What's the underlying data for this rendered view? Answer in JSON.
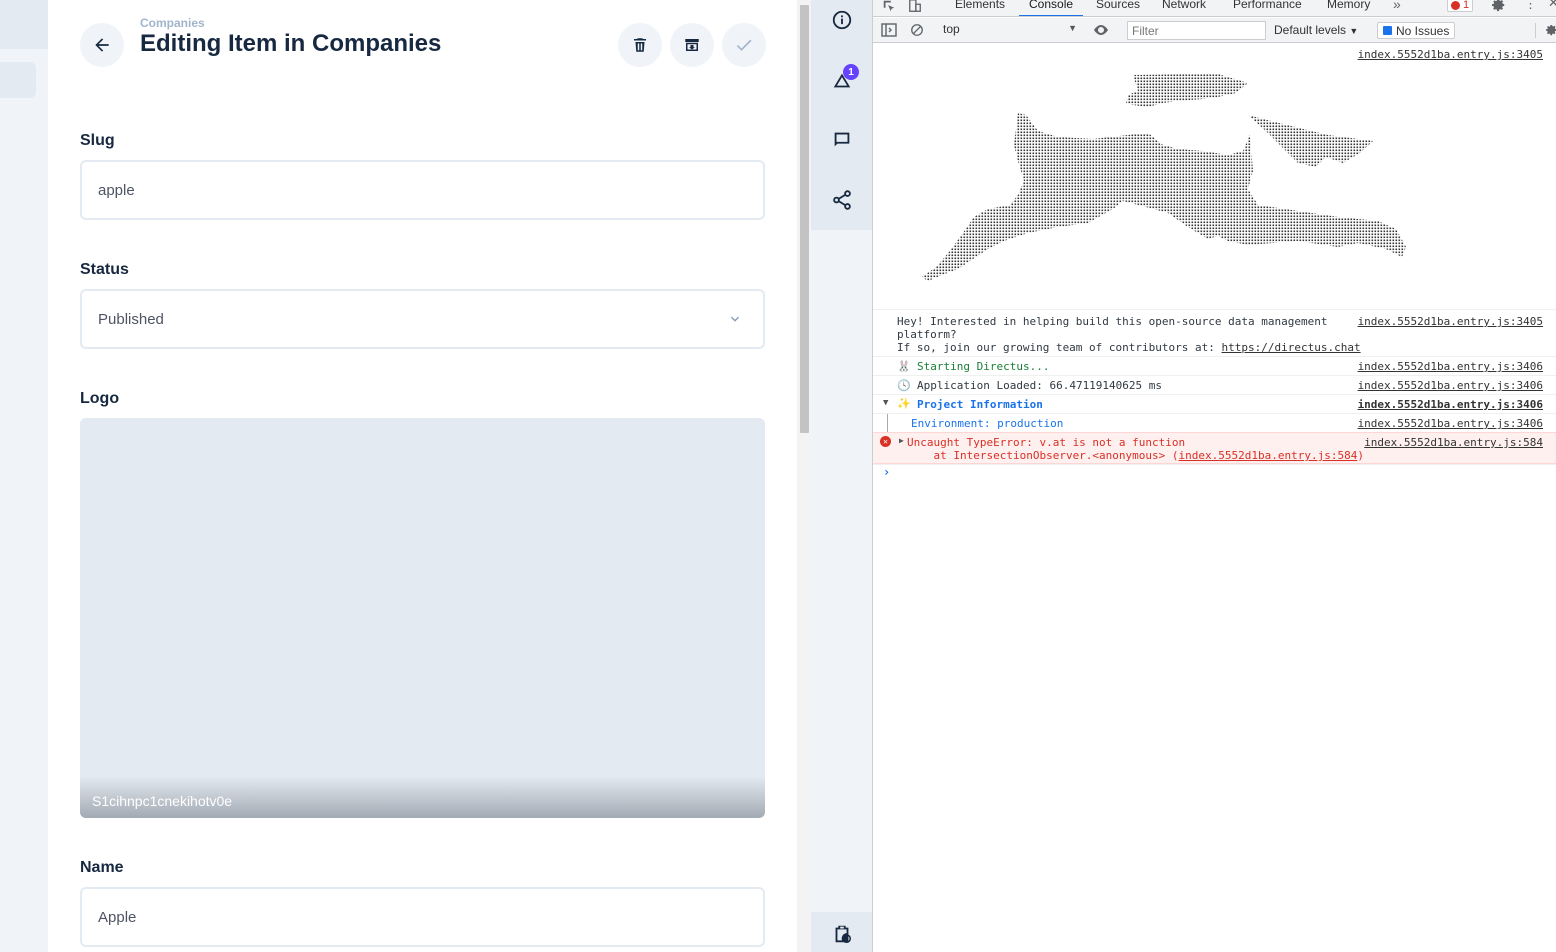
{
  "editor": {
    "breadcrumb": "Companies",
    "title": "Editing Item in Companies",
    "fields": {
      "slug": {
        "label": "Slug",
        "value": "apple"
      },
      "status": {
        "label": "Status",
        "value": "Published"
      },
      "logo": {
        "label": "Logo",
        "filename": "S1cihnpc1cnekihotv0e"
      },
      "name": {
        "label": "Name",
        "value": "Apple"
      }
    }
  },
  "sidebar": {
    "badge": "1"
  },
  "devtools": {
    "tabs": [
      "Elements",
      "Console",
      "Sources",
      "Network",
      "Performance",
      "Memory"
    ],
    "active_tab": "Console",
    "error_count": "1",
    "context": "top",
    "filter_placeholder": "Filter",
    "levels": "Default levels",
    "issues": "No Issues",
    "console": {
      "ascii_link": "index.5552d1ba.entry.js:3405",
      "hey_line1": "Hey! Interested in helping build this open-source data management",
      "hey_line2": "platform?",
      "hey_line3_prefix": "If so, join our growing team of contributors at: ",
      "hey_url": "https://directus.chat",
      "hey_link": "index.5552d1ba.entry.js:3405",
      "starting": "Starting Directus...",
      "starting_link": "index.5552d1ba.entry.js:3406",
      "loaded": "Application Loaded: 66.47119140625 ms",
      "loaded_link": "index.5552d1ba.entry.js:3406",
      "project": "Project Information",
      "project_link": "index.5552d1ba.entry.js:3406",
      "env": "Environment: production",
      "env_link": "index.5552d1ba.entry.js:3406",
      "error_line1": "Uncaught TypeError: v.at is not a function",
      "error_line2_prefix": "    at IntersectionObserver.<anonymous> (",
      "error_line2_link": "index.5552d1ba.entry.js:584",
      "error_line2_suffix": ")",
      "error_link": "index.5552d1ba.entry.js:584"
    }
  },
  "colors": {
    "primary_text": "#172940",
    "muted": "#a2b5cd",
    "badge": "#6644ff",
    "console_error": "#d93025",
    "console_green": "#188038",
    "console_blue": "#1a73e8"
  }
}
